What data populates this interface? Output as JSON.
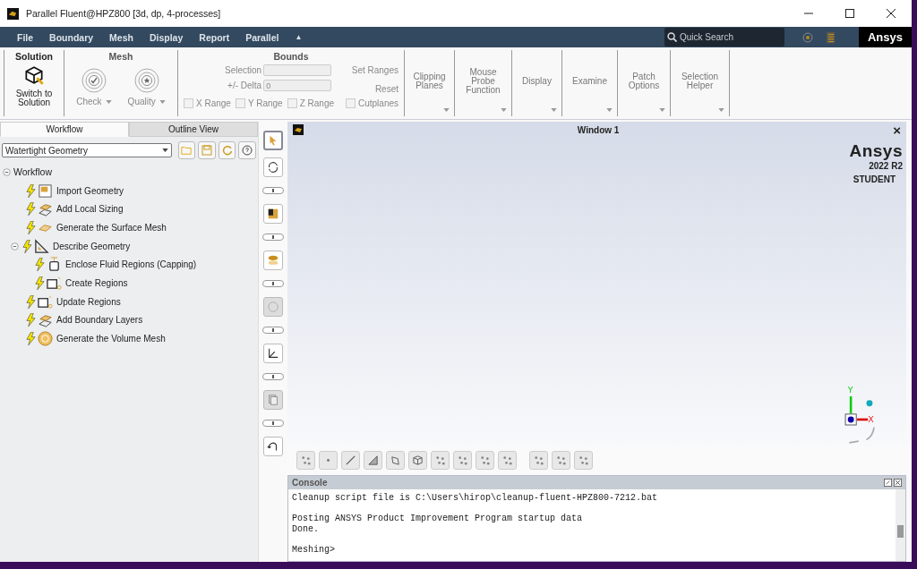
{
  "window": {
    "title": "Parallel Fluent@HPZ800  [3d, dp, 4-processes]"
  },
  "menu": {
    "items": [
      {
        "label": "File"
      },
      {
        "label": "Boundary"
      },
      {
        "label": "Mesh"
      },
      {
        "label": "Display"
      },
      {
        "label": "Report"
      },
      {
        "label": "Parallel"
      }
    ],
    "collapse": "▲",
    "search": {
      "placeholder": "Quick Search"
    },
    "logo": "Ansys"
  },
  "ribbon": {
    "solution": {
      "title": "Solution",
      "button": "Switch to\nSolution"
    },
    "mesh": {
      "title": "Mesh",
      "buttons": [
        {
          "label": "Check",
          "kind": "check"
        },
        {
          "label": "Quality",
          "kind": "quality"
        }
      ]
    },
    "bounds": {
      "title": "Bounds",
      "fields": [
        {
          "label": "Selection"
        },
        {
          "label": "+/- Delta",
          "value": "0"
        }
      ],
      "actions": [
        "Set Ranges",
        "Reset"
      ],
      "checks": [
        {
          "label": "X Range",
          "checked": false
        },
        {
          "label": "Y Range",
          "checked": false
        },
        {
          "label": "Z Range",
          "checked": false
        },
        {
          "label": "Cutplanes",
          "checked": false
        }
      ]
    },
    "groups": [
      "Clipping\nPlanes",
      "Mouse\nProbe\nFunction",
      "Display",
      "Examine",
      "Patch\nOptions",
      "Selection\nHelper"
    ]
  },
  "tabs": [
    {
      "label": "Workflow",
      "selected": true
    },
    {
      "label": "Outline View",
      "selected": false
    }
  ],
  "workflow_select": {
    "value": "Watertight Geometry"
  },
  "tree": {
    "label": "Workflow",
    "expanded": true,
    "children": [
      {
        "label": "Import Geometry",
        "kind": "import"
      },
      {
        "label": "Add Local Sizing",
        "kind": "sizing"
      },
      {
        "label": "Generate the Surface Mesh",
        "kind": "surface"
      },
      {
        "label": "Describe Geometry",
        "kind": "describe",
        "expanded": true,
        "children": [
          {
            "label": "Enclose Fluid Regions (Capping)",
            "kind": "capping"
          },
          {
            "label": "Create Regions",
            "kind": "regions"
          }
        ]
      },
      {
        "label": "Update Regions",
        "kind": "regions"
      },
      {
        "label": "Add Boundary Layers",
        "kind": "layers"
      },
      {
        "label": "Generate the Volume Mesh",
        "kind": "volume"
      }
    ]
  },
  "graphics": {
    "title": "Window 1",
    "close": "×",
    "logo": "Ansys",
    "version": "2022 R2",
    "edition": "STUDENT",
    "axes": [
      "Y",
      "X"
    ]
  },
  "console": {
    "title": "Console",
    "blocks": [
      [
        "Cleanup script file is C:\\Users\\hirop\\cleanup-fluent-HPZ800-7212.bat"
      ],
      [
        "Posting ANSYS Product Improvement Program startup data",
        "Done."
      ]
    ],
    "prompt": "Meshing>"
  }
}
